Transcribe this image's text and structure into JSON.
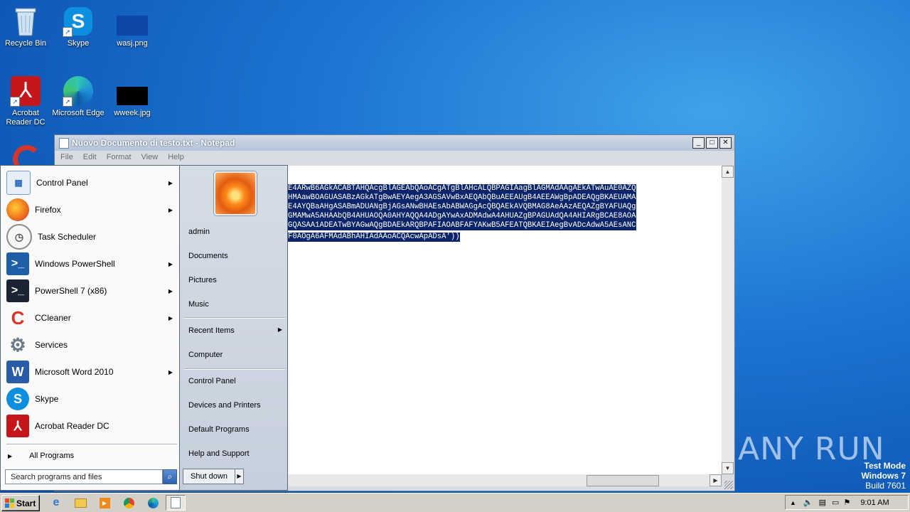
{
  "desktop": {
    "icons": [
      {
        "label": "Recycle Bin",
        "icon": "recycle-bin-icon"
      },
      {
        "label": "Skype",
        "icon": "skype-icon"
      },
      {
        "label": "wasj.png",
        "icon": "image-file-icon"
      },
      {
        "label": "Acrobat Reader DC",
        "icon": "acrobat-icon"
      },
      {
        "label": "Microsoft Edge",
        "icon": "edge-icon"
      },
      {
        "label": "wweek.jpg",
        "icon": "image-file-icon"
      }
    ]
  },
  "notepad": {
    "title": "Nuovo Documento di testo.txt - Notepad",
    "menu": [
      "File",
      "Edit",
      "Format",
      "View",
      "Help"
    ],
    "lines": [
      "E4ARwB6AGkACABTAHQAcgBlAGEAbQAoACgATgBlAHcALQBPAGIAagBlAGMAdAAgAEkATwAuAE0AZQ",
      "HMAawBOAGUASABzAGkATgBwAEYAegA3AGSAVwBxAEQAbQBuAEEAUgB4AEEAWgBpADEAQgBKAEUAMA",
      "E4AYQBaAHgASABmADUANgBjAGsANwBHAEsAbABWAGgAcQBQAEkAVQBMAG8AeAAzAEQAZgBYAFUAQg",
      "GMAMwA5AHAAbQB4AHUAOQA0AHYAQQA4ADgAYwAxADMAdwA4AHUAZgBPAGUAdQA4AHIARgBCAE8AOA",
      "GQASAA1ADEATwBYAGwAQgBDAEkARQBPAFIAOABFAFYAKwB5AFEATQBKAEIAegBvADcAdwA5AEsANC",
      "F0AOgA6AFMAdABhAHIAdAAoACQAcwApADsA'))"
    ]
  },
  "start_menu": {
    "programs": [
      {
        "label": "Control Panel",
        "icon": "control-panel-icon",
        "submenu": true
      },
      {
        "label": "Firefox",
        "icon": "firefox-icon",
        "submenu": true
      },
      {
        "label": "Task Scheduler",
        "icon": "clock-icon",
        "submenu": false
      },
      {
        "label": "Windows PowerShell",
        "icon": "powershell-icon",
        "submenu": true
      },
      {
        "label": "PowerShell 7 (x86)",
        "icon": "powershell7-icon",
        "submenu": true
      },
      {
        "label": "CCleaner",
        "icon": "ccleaner-icon",
        "submenu": true
      },
      {
        "label": "Services",
        "icon": "gears-icon",
        "submenu": false
      },
      {
        "label": "Microsoft Word 2010",
        "icon": "word-icon",
        "submenu": true
      },
      {
        "label": "Skype",
        "icon": "skype-icon",
        "submenu": false
      },
      {
        "label": "Acrobat Reader DC",
        "icon": "acrobat-icon",
        "submenu": false
      }
    ],
    "all_programs": "All Programs",
    "search_placeholder": "Search programs and files",
    "right": {
      "user": "admin",
      "group1": [
        "Documents",
        "Pictures",
        "Music"
      ],
      "recent": "Recent Items",
      "computer": "Computer",
      "group2": [
        "Control Panel",
        "Devices and Printers",
        "Default Programs",
        "Help and Support"
      ]
    },
    "shutdown": "Shut down"
  },
  "taskbar": {
    "start": "Start",
    "clock": "9:01 AM"
  },
  "watermark": "ANY RUN",
  "test_mode": [
    "Test Mode",
    "Windows 7",
    "Build 7601"
  ]
}
